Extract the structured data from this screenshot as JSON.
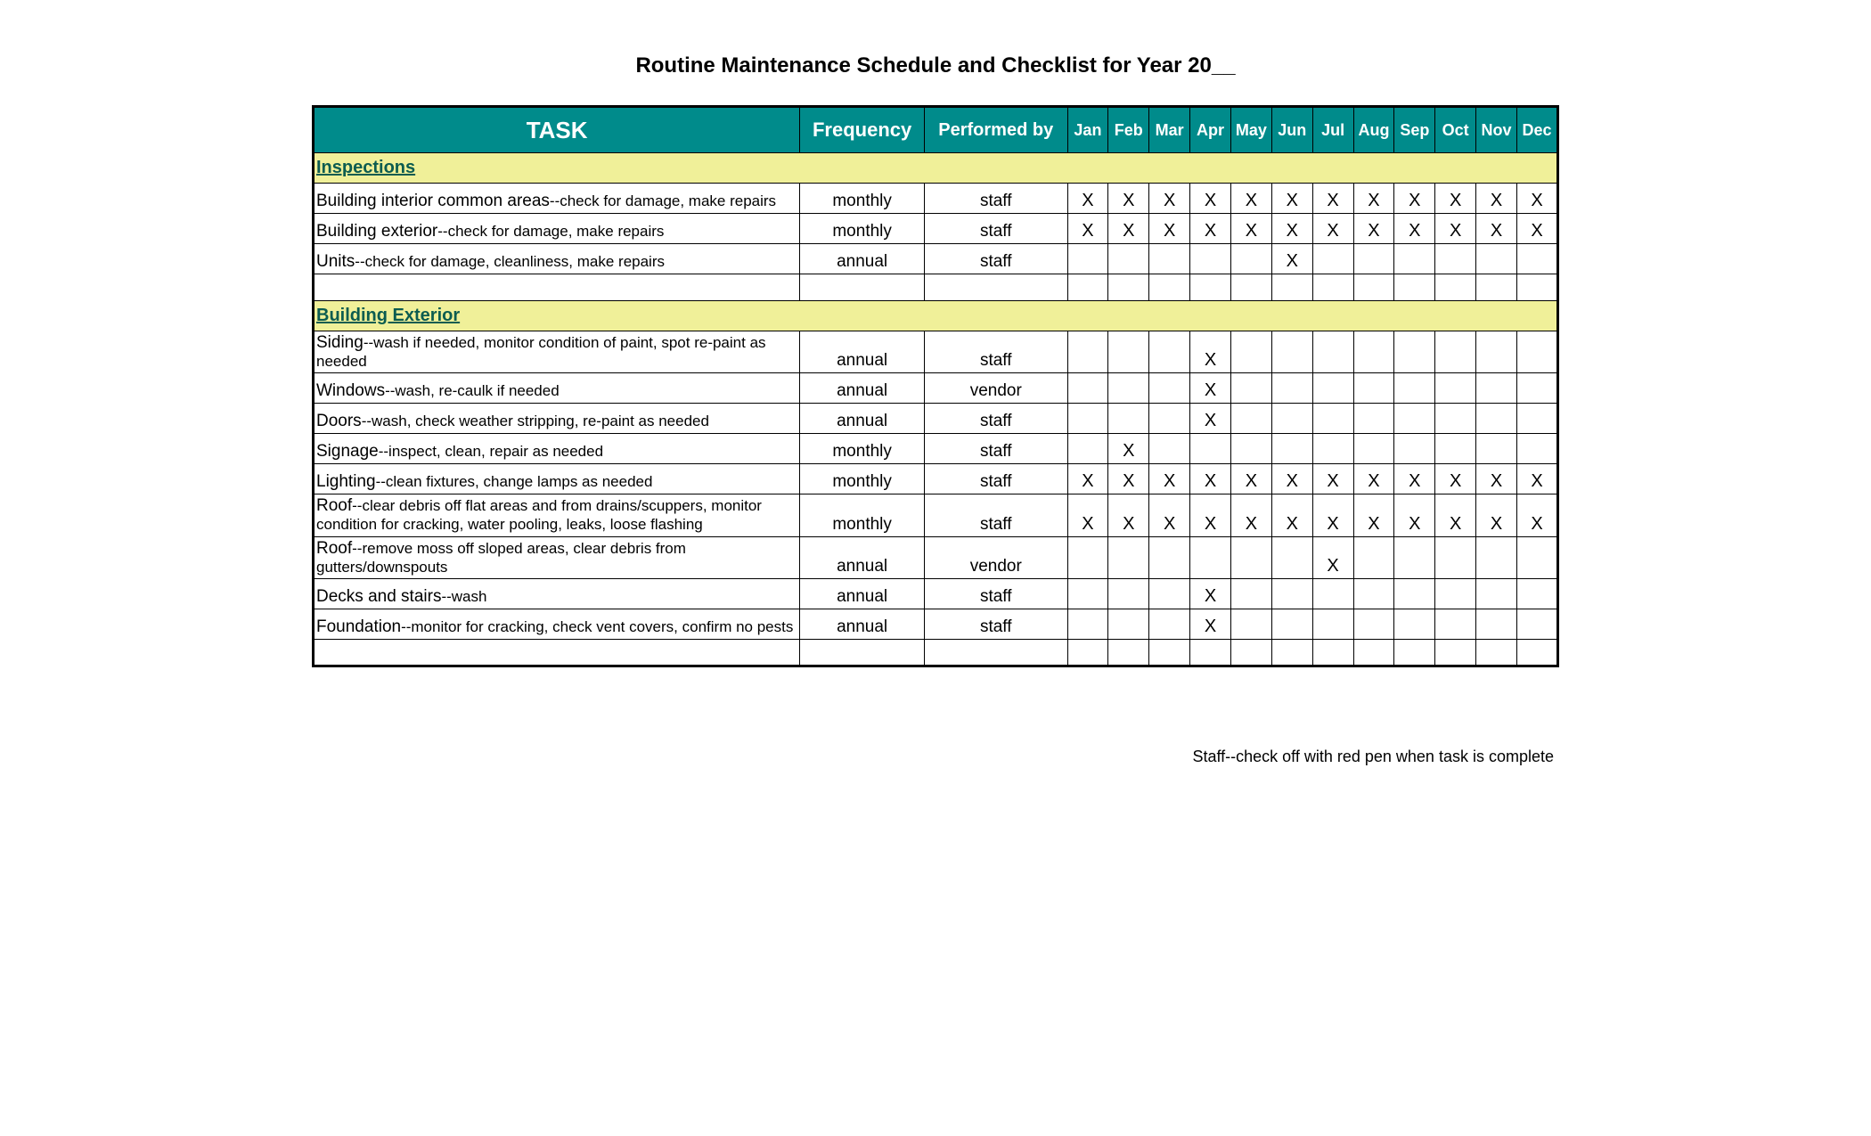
{
  "title": "Routine Maintenance Schedule and Checklist for Year 20__",
  "columns": {
    "task": "TASK",
    "frequency": "Frequency",
    "performed_by": "Performed by",
    "months": [
      "Jan",
      "Feb",
      "Mar",
      "Apr",
      "May",
      "Jun",
      "Jul",
      "Aug",
      "Sep",
      "Oct",
      "Nov",
      "Dec"
    ]
  },
  "mark": "X",
  "sections": [
    {
      "label": "Inspections",
      "rows": [
        {
          "name": "Building interior common areas",
          "desc": "--check for damage, make repairs",
          "frequency": "monthly",
          "performed_by": "staff",
          "months": [
            true,
            true,
            true,
            true,
            true,
            true,
            true,
            true,
            true,
            true,
            true,
            true
          ]
        },
        {
          "name": "Building exterior",
          "desc": "--check for damage, make repairs",
          "frequency": "monthly",
          "performed_by": "staff",
          "months": [
            true,
            true,
            true,
            true,
            true,
            true,
            true,
            true,
            true,
            true,
            true,
            true
          ]
        },
        {
          "name": "Units",
          "desc": "--check for damage, cleanliness, make repairs",
          "frequency": "annual",
          "performed_by": "staff",
          "months": [
            false,
            false,
            false,
            false,
            false,
            true,
            false,
            false,
            false,
            false,
            false,
            false
          ]
        }
      ]
    },
    {
      "label": "Building Exterior",
      "rows": [
        {
          "name": "Siding",
          "desc": "--wash if needed, monitor condition of paint, spot re-paint as needed",
          "frequency": "annual",
          "performed_by": "staff",
          "months": [
            false,
            false,
            false,
            true,
            false,
            false,
            false,
            false,
            false,
            false,
            false,
            false
          ]
        },
        {
          "name": "Windows",
          "desc": "--wash, re-caulk if needed",
          "frequency": "annual",
          "performed_by": "vendor",
          "months": [
            false,
            false,
            false,
            true,
            false,
            false,
            false,
            false,
            false,
            false,
            false,
            false
          ]
        },
        {
          "name": "Doors",
          "desc": "--wash, check weather stripping, re-paint as needed",
          "frequency": "annual",
          "performed_by": "staff",
          "months": [
            false,
            false,
            false,
            true,
            false,
            false,
            false,
            false,
            false,
            false,
            false,
            false
          ]
        },
        {
          "name": "Signage",
          "desc": "--inspect, clean, repair as needed",
          "frequency": "monthly",
          "performed_by": "staff",
          "months": [
            false,
            true,
            false,
            false,
            false,
            false,
            false,
            false,
            false,
            false,
            false,
            false
          ]
        },
        {
          "name": "Lighting",
          "desc": "--clean fixtures, change lamps as needed",
          "frequency": "monthly",
          "performed_by": "staff",
          "months": [
            true,
            true,
            true,
            true,
            true,
            true,
            true,
            true,
            true,
            true,
            true,
            true
          ]
        },
        {
          "name": "Roof",
          "desc": "--clear debris off flat areas and from drains/scuppers, monitor condition for cracking, water pooling, leaks, loose flashing",
          "frequency": "monthly",
          "performed_by": "staff",
          "tall": true,
          "months": [
            true,
            true,
            true,
            true,
            true,
            true,
            true,
            true,
            true,
            true,
            true,
            true
          ]
        },
        {
          "name": "Roof",
          "desc": "--remove moss off sloped areas, clear debris from gutters/downspouts",
          "frequency": "annual",
          "performed_by": "vendor",
          "months": [
            false,
            false,
            false,
            false,
            false,
            false,
            true,
            false,
            false,
            false,
            false,
            false
          ]
        },
        {
          "name": "Decks and stairs",
          "desc": "--wash",
          "frequency": "annual",
          "performed_by": "staff",
          "months": [
            false,
            false,
            false,
            true,
            false,
            false,
            false,
            false,
            false,
            false,
            false,
            false
          ]
        },
        {
          "name": "Foundation",
          "desc": "--monitor for cracking, check vent covers, confirm no pests",
          "frequency": "annual",
          "performed_by": "staff",
          "months": [
            false,
            false,
            false,
            true,
            false,
            false,
            false,
            false,
            false,
            false,
            false,
            false
          ]
        }
      ]
    }
  ],
  "footnote": "Staff--check off with red pen when task is complete"
}
